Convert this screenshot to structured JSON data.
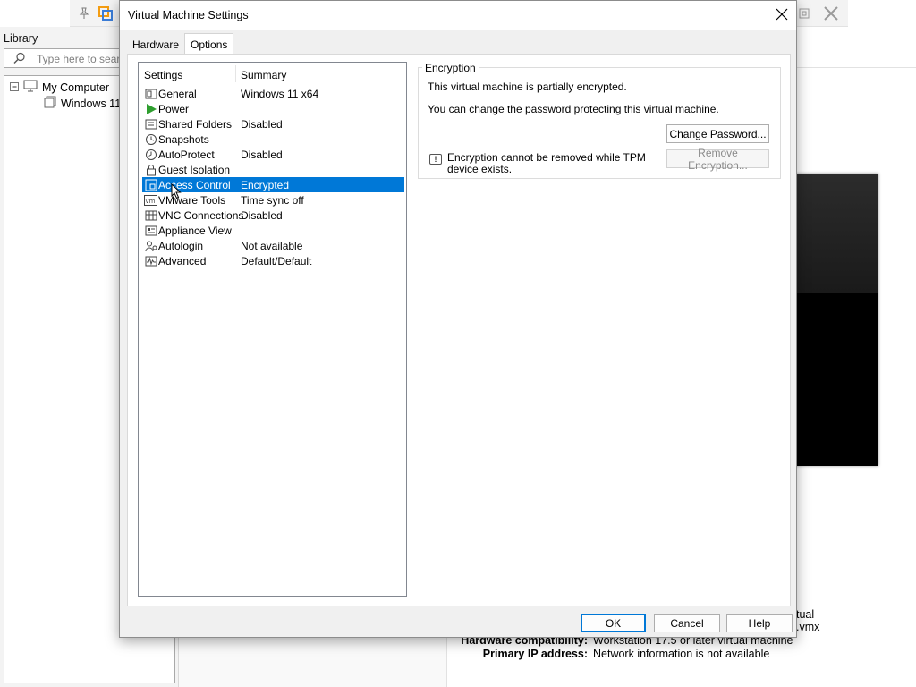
{
  "background": {
    "library_title": "Library",
    "search_placeholder": "Type here to search",
    "tree": {
      "root": "My Computer",
      "child": "Windows 11"
    },
    "details": [
      {
        "key": "Hardware compatibility:",
        "value": "Workstation 17.5 or later virtual machine"
      },
      {
        "key": "Primary IP address:",
        "value": "Network information is not available"
      }
    ],
    "partial_right_1": "tual",
    "partial_right_2": ".vmx"
  },
  "dialog": {
    "title": "Virtual Machine Settings",
    "tabs": [
      {
        "label": "Hardware",
        "active": false
      },
      {
        "label": "Options",
        "active": true
      }
    ],
    "list_header": {
      "settings": "Settings",
      "summary": "Summary"
    },
    "items": [
      {
        "name": "General",
        "summary": "Windows 11 x64",
        "icon": "general-icon"
      },
      {
        "name": "Power",
        "summary": "",
        "icon": "power-play-icon"
      },
      {
        "name": "Shared Folders",
        "summary": "Disabled",
        "icon": "shared-folders-icon"
      },
      {
        "name": "Snapshots",
        "summary": "",
        "icon": "snapshots-icon"
      },
      {
        "name": "AutoProtect",
        "summary": "Disabled",
        "icon": "autoprotect-icon"
      },
      {
        "name": "Guest Isolation",
        "summary": "",
        "icon": "lock-icon"
      },
      {
        "name": "Access Control",
        "summary": "Encrypted",
        "icon": "access-control-icon",
        "selected": true
      },
      {
        "name": "VMware Tools",
        "summary": "Time sync off",
        "icon": "vmware-tools-icon"
      },
      {
        "name": "VNC Connections",
        "summary": "Disabled",
        "icon": "vnc-icon"
      },
      {
        "name": "Appliance View",
        "summary": "",
        "icon": "appliance-view-icon"
      },
      {
        "name": "Autologin",
        "summary": "Not available",
        "icon": "autologin-icon"
      },
      {
        "name": "Advanced",
        "summary": "Default/Default",
        "icon": "advanced-icon"
      }
    ],
    "encryption": {
      "legend": "Encryption",
      "status_text": "This virtual machine is partially encrypted.",
      "password_text": "You can change the password protecting this virtual machine.",
      "change_password_label": "Change Password...",
      "warning_text": "Encryption cannot be removed while TPM device exists.",
      "remove_encryption_label": "Remove Encryption..."
    },
    "buttons": {
      "ok": "OK",
      "cancel": "Cancel",
      "help": "Help"
    }
  },
  "colors": {
    "selection": "#0078d7",
    "power_green": "#2e9e2e",
    "vmware_orange": "#f39c12"
  }
}
